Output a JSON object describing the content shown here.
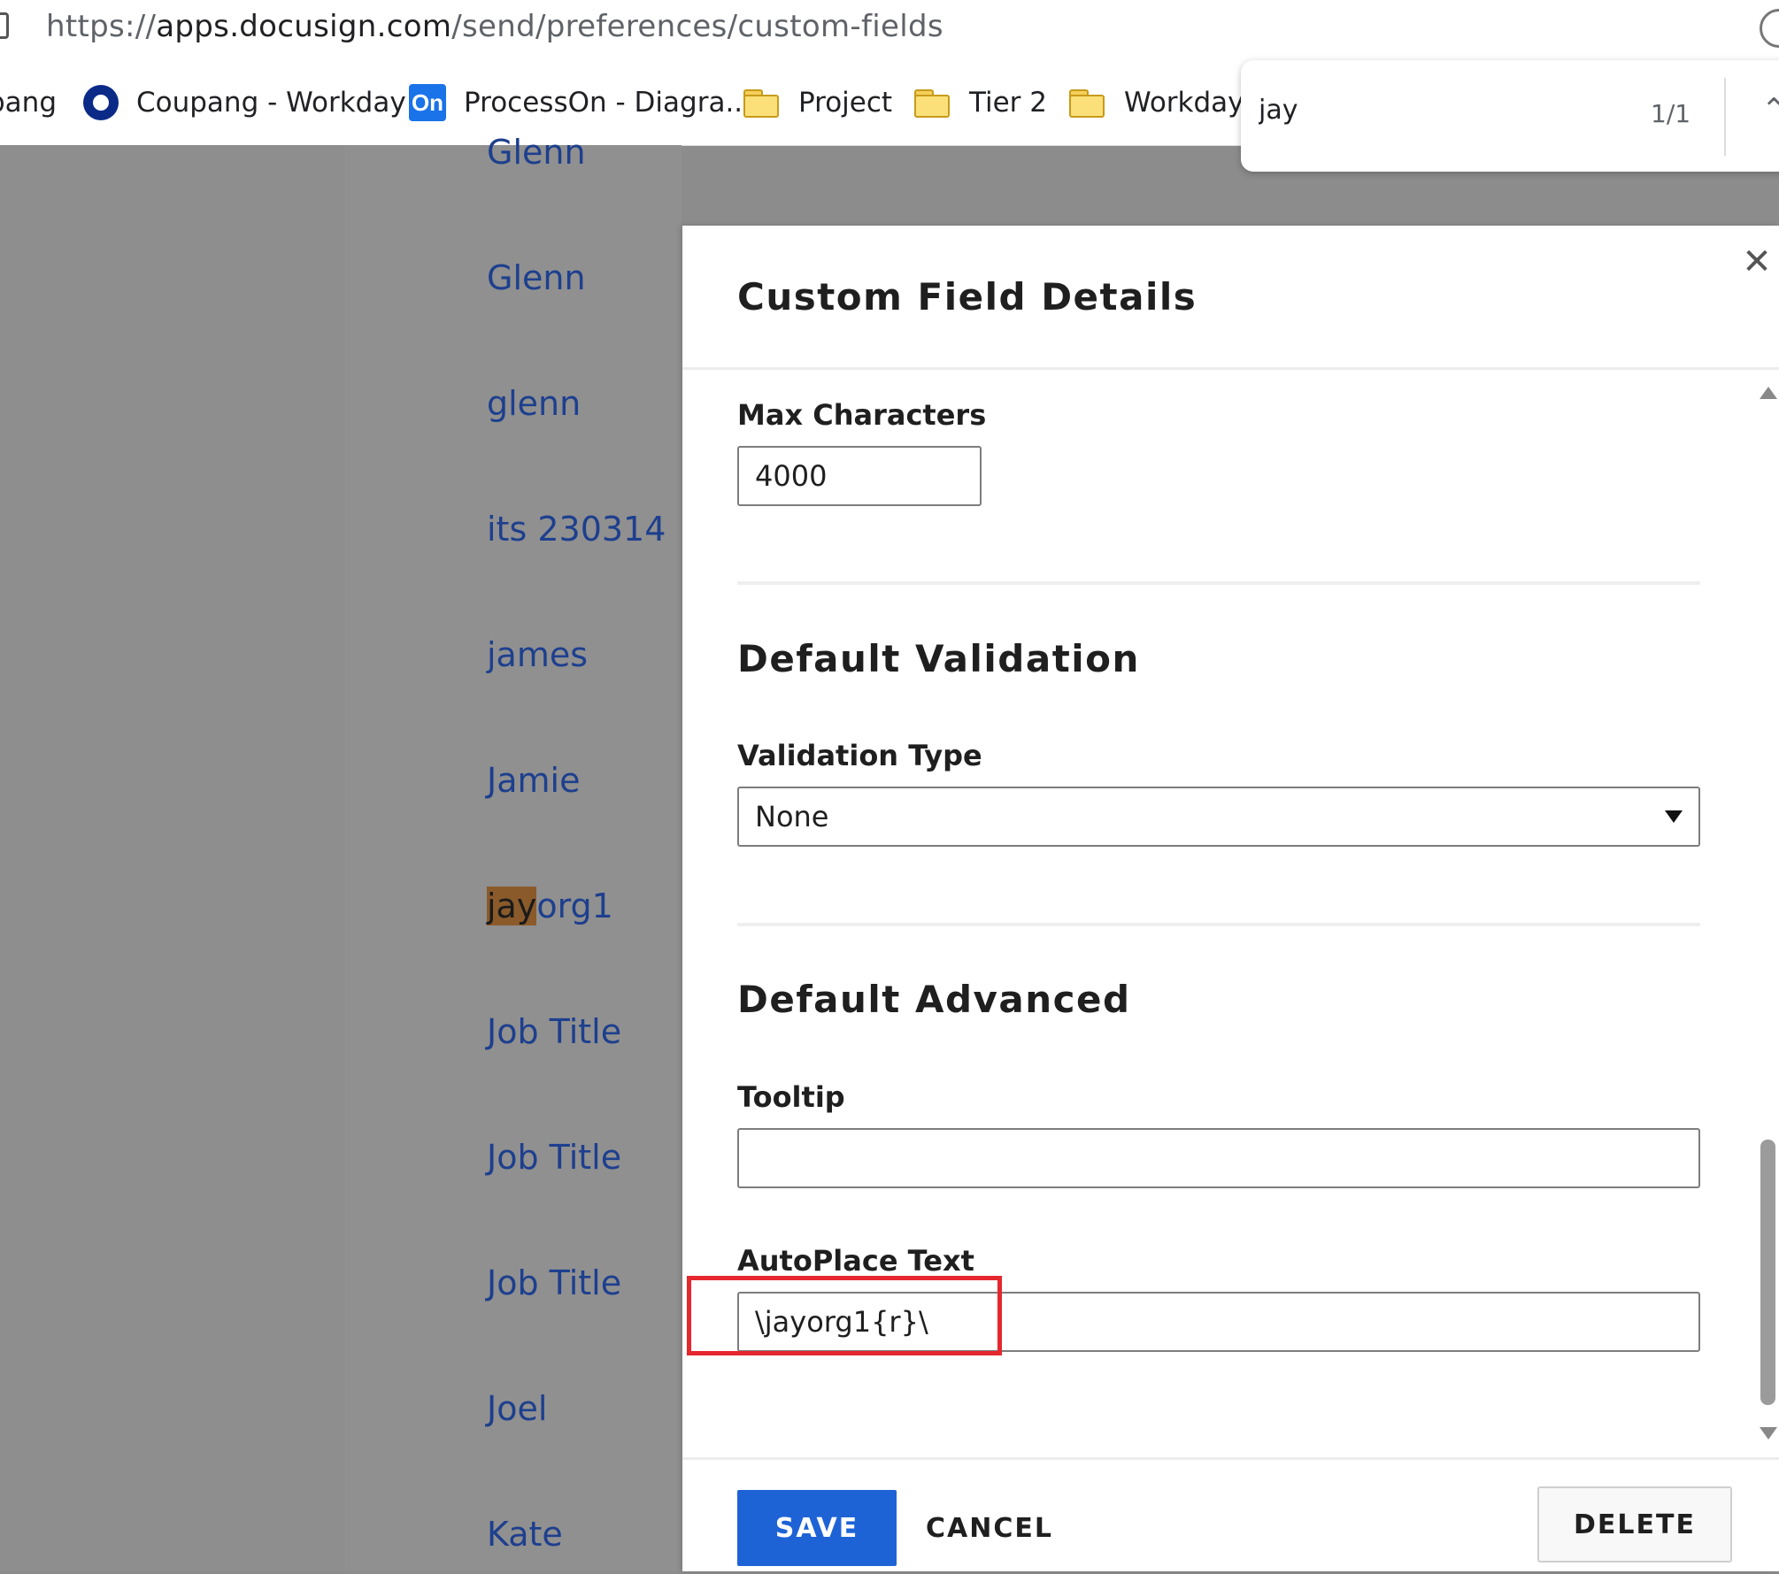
{
  "browser": {
    "url_prefix": "https://",
    "url_host": "apps.docusign.com",
    "url_path": "/send/preferences/custom-fields",
    "bookmarks": [
      {
        "label": "pang",
        "icon": "favicon-partial"
      },
      {
        "label": "Coupang - Workday",
        "icon": "workday-ring-icon"
      },
      {
        "label": "ProcessOn - Diagra...",
        "icon": "processon-icon",
        "icon_text": "On"
      },
      {
        "label": "Project",
        "icon": "folder-icon"
      },
      {
        "label": "Tier 2",
        "icon": "folder-icon"
      },
      {
        "label": "Workday",
        "icon": "folder-icon"
      }
    ],
    "find": {
      "query": "jay",
      "count": "1/1"
    }
  },
  "list": {
    "items": [
      "Glenn",
      "Glenn",
      "glenn",
      "its 230314",
      "james",
      "Jamie",
      "jayorg1",
      "Job Title",
      "Job Title",
      "Job Title",
      "Joel",
      "Kate"
    ],
    "highlight": {
      "match": "jay",
      "rest": "org1"
    }
  },
  "modal": {
    "title": "Custom Field Details",
    "max_characters": {
      "label": "Max Characters",
      "value": "4000"
    },
    "default_validation": {
      "title": "Default Validation",
      "validation_type_label": "Validation Type",
      "validation_type_value": "None"
    },
    "default_advanced": {
      "title": "Default Advanced",
      "tooltip_label": "Tooltip",
      "tooltip_value": "",
      "autoplace_label": "AutoPlace Text",
      "autoplace_value": "\\jayorg1{r}\\"
    },
    "buttons": {
      "save": "SAVE",
      "cancel": "CANCEL",
      "delete": "DELETE"
    }
  },
  "colors": {
    "primary": "#1e63d6",
    "highlight_box": "#e5272e",
    "link": "#1d3f8e",
    "find_match": "#8a5a2b"
  }
}
